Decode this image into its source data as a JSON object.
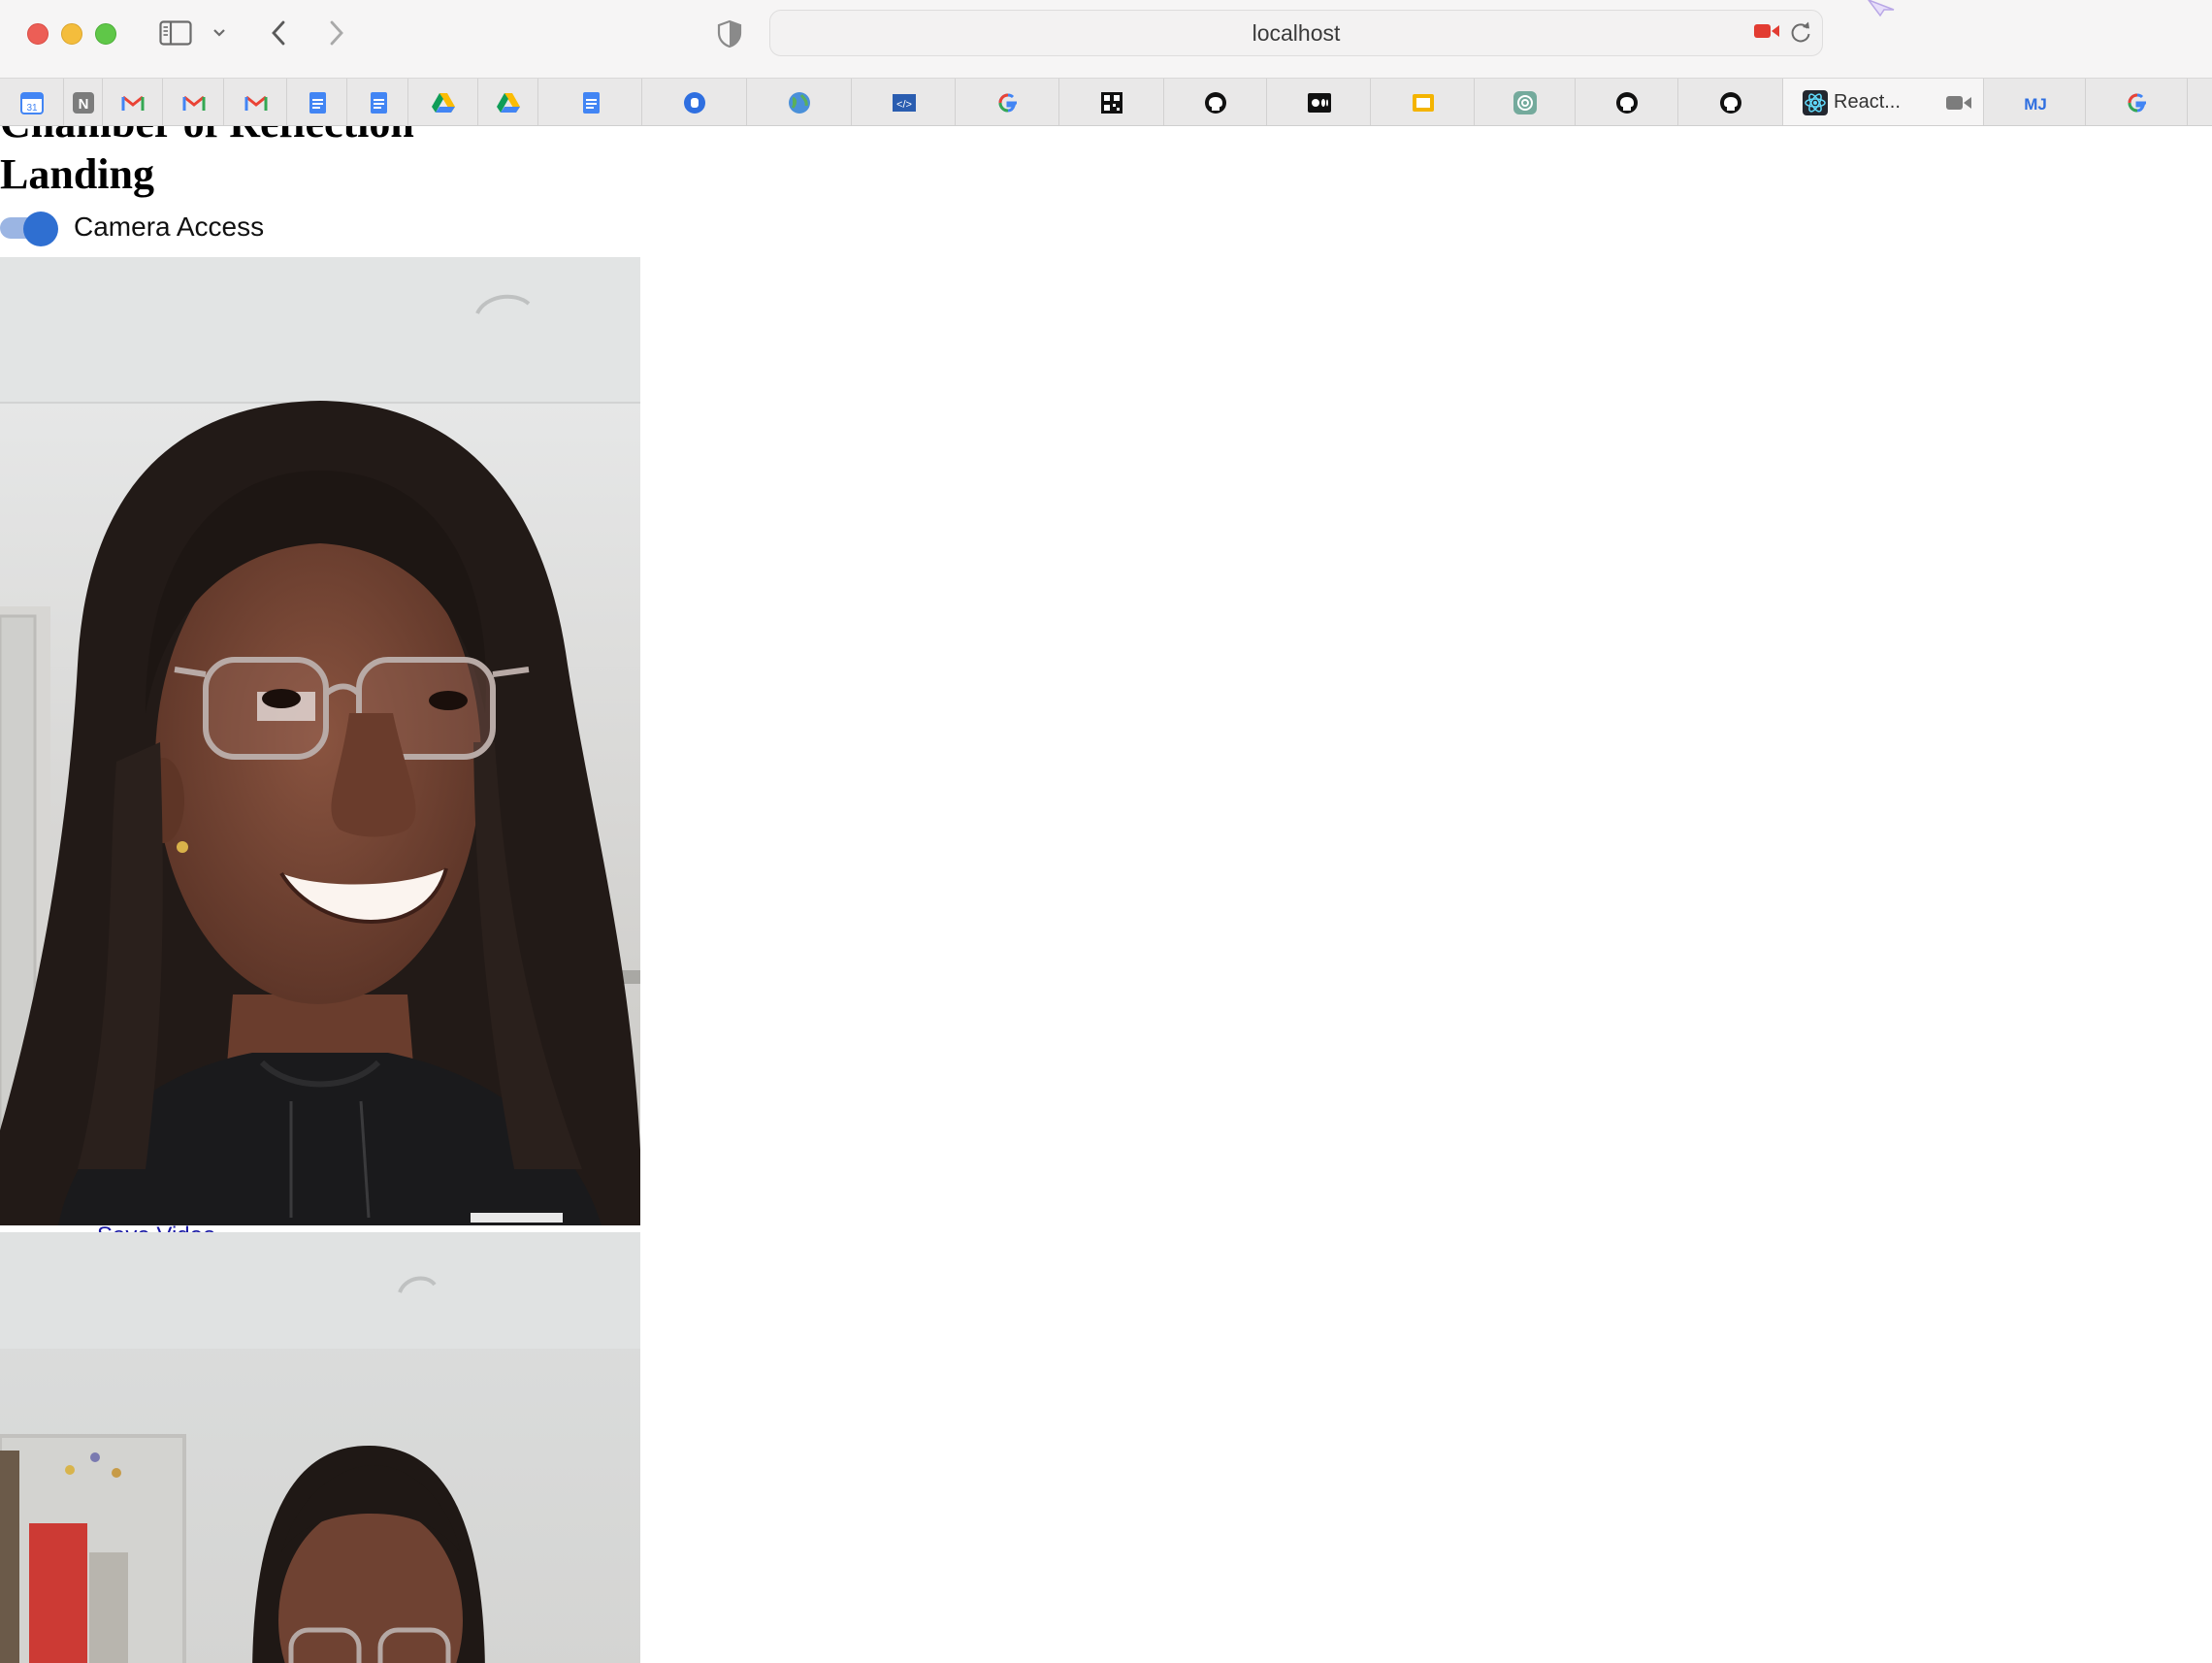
{
  "browser": {
    "address": "localhost",
    "tabs": [
      {
        "icon": "google-calendar-icon"
      },
      {
        "icon": "notion-icon"
      },
      {
        "icon": "gmail-icon"
      },
      {
        "icon": "gmail-icon"
      },
      {
        "icon": "gmail-icon"
      },
      {
        "icon": "google-docs-icon"
      },
      {
        "icon": "google-docs-icon"
      },
      {
        "icon": "google-drive-icon"
      },
      {
        "icon": "google-drive-icon"
      },
      {
        "icon": "google-docs-icon"
      },
      {
        "icon": "blue-circle-icon"
      },
      {
        "icon": "globe-icon"
      },
      {
        "icon": "code-icon"
      },
      {
        "icon": "google-icon"
      },
      {
        "icon": "qr-icon"
      },
      {
        "icon": "github-icon"
      },
      {
        "icon": "medium-icon"
      },
      {
        "icon": "google-slides-icon"
      },
      {
        "icon": "chatgpt-icon"
      },
      {
        "icon": "github-icon"
      },
      {
        "icon": "github-icon"
      },
      {
        "icon": "react-icon",
        "title": "React...",
        "active": true
      },
      {
        "icon": "mj-icon"
      },
      {
        "icon": "google-icon"
      }
    ]
  },
  "page": {
    "title_line1": "Chamber of Reflection",
    "title_line2": "Landing",
    "toggle_label": "Camera Access",
    "toggle_on": true,
    "peek_link": "Save Video"
  },
  "colors": {
    "toggle_knob": "#2f6fd1",
    "toggle_track": "#9bb5e3"
  }
}
